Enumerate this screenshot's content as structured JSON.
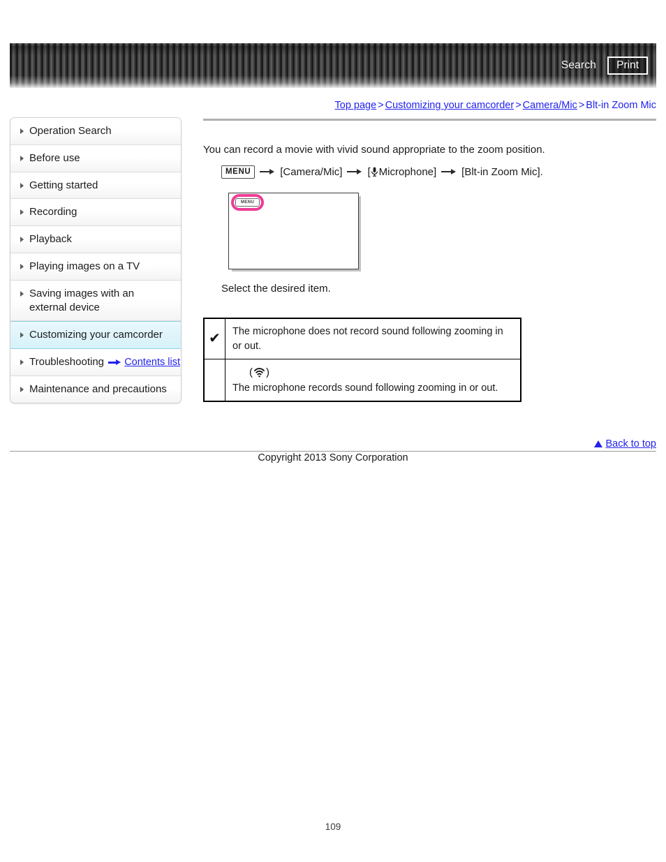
{
  "header": {
    "search_label": "Search",
    "print_label": "Print"
  },
  "breadcrumb": {
    "separator": ">",
    "items": [
      {
        "label": "Top page"
      },
      {
        "label": "Customizing your camcorder"
      },
      {
        "label": "Camera/Mic"
      },
      {
        "label": "Blt-in Zoom Mic"
      }
    ]
  },
  "sidebar": {
    "items": [
      {
        "label": "Operation Search",
        "active": false
      },
      {
        "label": "Before use",
        "active": false
      },
      {
        "label": "Getting started",
        "active": false
      },
      {
        "label": "Recording",
        "active": false
      },
      {
        "label": "Playback",
        "active": false
      },
      {
        "label": "Playing images on a TV",
        "active": false
      },
      {
        "label": "Saving images with an external device",
        "active": false
      },
      {
        "label": "Customizing your camcorder",
        "active": true
      },
      {
        "label": "Troubleshooting",
        "active": false
      },
      {
        "label": "Maintenance and precautions",
        "active": false
      }
    ],
    "contents_list_label": "Contents list"
  },
  "main": {
    "intro_text": "You can record a movie with vivid sound appropriate to the zoom position.",
    "menu_path": {
      "menu_chip_label": "MENU",
      "step1": "[Camera/Mic]",
      "step2_prefix": "[",
      "step2_label": "Microphone]",
      "step3": "[Blt-in Zoom Mic]."
    },
    "screen_illustration": {
      "menu_chip_label": "MENU",
      "highlight_color": "#ee3d96"
    },
    "select_caption": "Select the desired item.",
    "options_table": {
      "rows": [
        {
          "selected_mark": "✔",
          "icon": "",
          "description": "The microphone does not record sound following zooming in or out."
        },
        {
          "selected_mark": "",
          "icon": "zoom-mic-icon",
          "description": "The microphone records sound following zooming in or out."
        }
      ]
    }
  },
  "footer": {
    "back_to_top_label": "Back to top",
    "copyright": "Copyright 2013 Sony Corporation",
    "page_number": "109"
  }
}
